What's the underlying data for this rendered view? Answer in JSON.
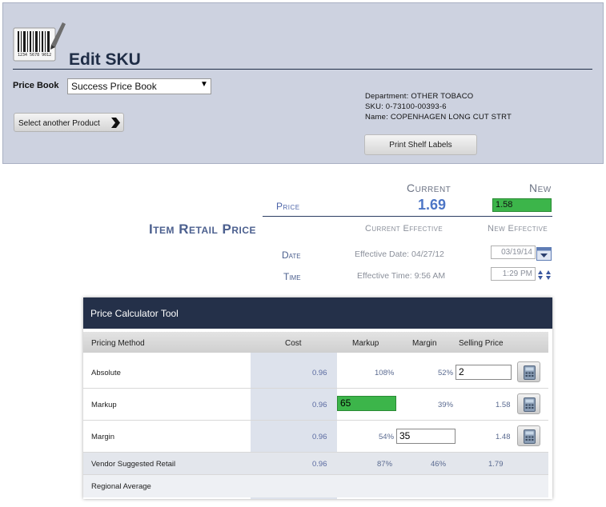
{
  "header": {
    "title": "Edit SKU",
    "price_book_label": "Price Book",
    "price_book_value": "Success Price Book",
    "select_product_label": "Select another Product",
    "department": "Department: OTHER TOBACO",
    "sku": "SKU: 0-73100-00393-6",
    "name": "Name: COPENHAGEN LONG CUT STRT",
    "print_labels_button": "Print Shelf Labels",
    "barcode_digits": "1234 5678 9012"
  },
  "retail": {
    "heading": "Item Retail Price",
    "current_label": "Current",
    "new_label": "New",
    "price_label": "Price",
    "current_price": "1.69",
    "new_price": "1.58",
    "current_effective_label": "Current Effective",
    "new_effective_label": "New Effective",
    "date_label": "Date",
    "effective_date": "Effective Date: 04/27/12",
    "new_date": "03/19/14",
    "time_label": "Time",
    "effective_time": "Effective Time: 9:56 AM",
    "new_time": "1:29 PM"
  },
  "calculator": {
    "title": "Price Calculator Tool",
    "columns": [
      "Pricing Method",
      "Cost",
      "Markup",
      "Margin",
      "Selling Price"
    ],
    "rows": {
      "absolute": {
        "method": "Absolute",
        "cost": "0.96",
        "markup": "108%",
        "margin": "52%",
        "selling_input": "2"
      },
      "markup": {
        "method": "Markup",
        "cost": "0.96",
        "markup_input": "65",
        "margin": "39%",
        "selling": "1.58"
      },
      "margin": {
        "method": "Margin",
        "cost": "0.96",
        "markup": "54%",
        "margin_input": "35",
        "selling": "1.48"
      },
      "vendor": {
        "method": "Vendor Suggested Retail",
        "cost": "0.96",
        "markup": "87%",
        "margin": "46%",
        "selling": "1.79"
      },
      "regional": {
        "method": "Regional Average"
      }
    }
  },
  "colors": {
    "header_bg": "#cdd2e0",
    "title_text": "#1f2d46",
    "accent_blue": "#4d76c6",
    "calc_header_bg": "#243049",
    "highlight_green": "#3cb54a"
  },
  "icons": [
    "barcode-pen-icon",
    "chevron-right-icon",
    "calendar-icon",
    "time-stepper-icon",
    "calculator-icon"
  ]
}
